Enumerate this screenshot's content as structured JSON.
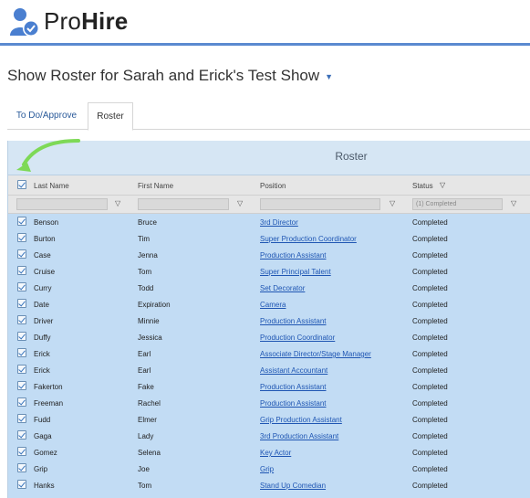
{
  "app": {
    "brand_part1": "Pro",
    "brand_part2": "Hire"
  },
  "page": {
    "title": "Show Roster for Sarah and Erick's Test Show"
  },
  "tabs": [
    {
      "label": "To Do/Approve"
    },
    {
      "label": "Roster"
    }
  ],
  "grid": {
    "title": "Roster",
    "columns": {
      "last": "Last Name",
      "first": "First Name",
      "position": "Position",
      "status": "Status"
    },
    "status_filter": "(1) Completed",
    "rows": [
      {
        "last": "Benson",
        "first": "Bruce",
        "position": "3rd Director",
        "status": "Completed"
      },
      {
        "last": "Burton",
        "first": "Tim",
        "position": "Super Production Coordinator",
        "status": "Completed"
      },
      {
        "last": "Case",
        "first": "Jenna",
        "position": "Production Assistant",
        "status": "Completed"
      },
      {
        "last": "Cruise",
        "first": "Tom",
        "position": "Super Principal Talent",
        "status": "Completed"
      },
      {
        "last": "Curry",
        "first": "Todd",
        "position": "Set Decorator",
        "status": "Completed"
      },
      {
        "last": "Date",
        "first": "Expiration",
        "position": "Camera",
        "status": "Completed"
      },
      {
        "last": "Driver",
        "first": "Minnie",
        "position": "Production Assistant",
        "status": "Completed"
      },
      {
        "last": "Duffy",
        "first": "Jessica",
        "position": "Production Coordinator",
        "status": "Completed"
      },
      {
        "last": "Erick",
        "first": "Earl",
        "position": "Associate Director/Stage Manager",
        "status": "Completed"
      },
      {
        "last": "Erick",
        "first": "Earl",
        "position": "Assistant Accountant",
        "status": "Completed"
      },
      {
        "last": "Fakerton",
        "first": "Fake",
        "position": "Production Assistant",
        "status": "Completed"
      },
      {
        "last": "Freeman",
        "first": "Rachel",
        "position": "Production Assistant",
        "status": "Completed"
      },
      {
        "last": "Fudd",
        "first": "Elmer",
        "position": "Grip Production Assistant",
        "status": "Completed"
      },
      {
        "last": "Gaga",
        "first": "Lady",
        "position": "3rd Production Assistant",
        "status": "Completed"
      },
      {
        "last": "Gomez",
        "first": "Selena",
        "position": "Key Actor",
        "status": "Completed"
      },
      {
        "last": "Grip",
        "first": "Joe",
        "position": "Grip",
        "status": "Completed"
      },
      {
        "last": "Hanks",
        "first": "Tom",
        "position": "Stand Up Comedian",
        "status": "Completed"
      }
    ]
  },
  "colors": {
    "accent": "#5b8ad0",
    "row_bg": "#c2dcf4",
    "link": "#1f56b3",
    "arrow": "#7ed957"
  },
  "icons": {
    "logo": "user-check-icon",
    "filter": "funnel-icon",
    "caret": "chevron-down-icon"
  }
}
